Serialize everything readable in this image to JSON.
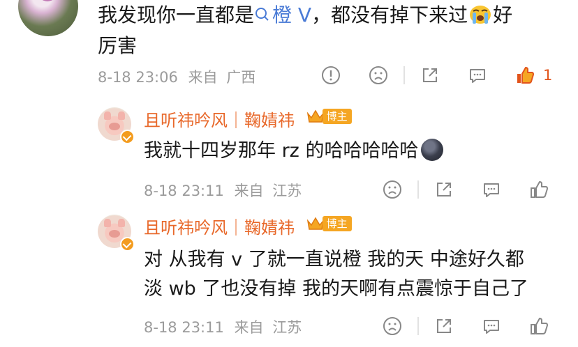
{
  "top_comment": {
    "text_line1": "我发现你一直都是",
    "tag_text": "橙 V",
    "text_after_tag": "，都没有掉下来过",
    "emoji": "crying-face",
    "text_end": "好",
    "text_line2": "厉害",
    "time": "8-18 23:06",
    "from_label": "来自",
    "location": "广西",
    "like_count": "1",
    "like_color": "#e2541b"
  },
  "replies": [
    {
      "author": "且听祎吟风｜鞠婧祎",
      "badge_label": "博主",
      "lines": [
        "我就十四岁那年 rz 的哈哈哈哈哈"
      ],
      "emoji": "new-moon-face",
      "time": "8-18 23:11",
      "from_label": "来自",
      "location": "江苏"
    },
    {
      "author": "且听祎吟风｜鞠婧祎",
      "badge_label": "博主",
      "lines": [
        "对 从我有 v 了就一直说橙 我的天 中途好久都",
        "淡 wb 了也没有掉 我的天啊有点震惊于自己了"
      ],
      "time": "8-18 23:11",
      "from_label": "来自",
      "location": "江苏"
    }
  ],
  "colors": {
    "name": "#e8682a",
    "tag": "#4a7bd6",
    "meta": "#9b9b9b",
    "badge": "#f5a623"
  }
}
